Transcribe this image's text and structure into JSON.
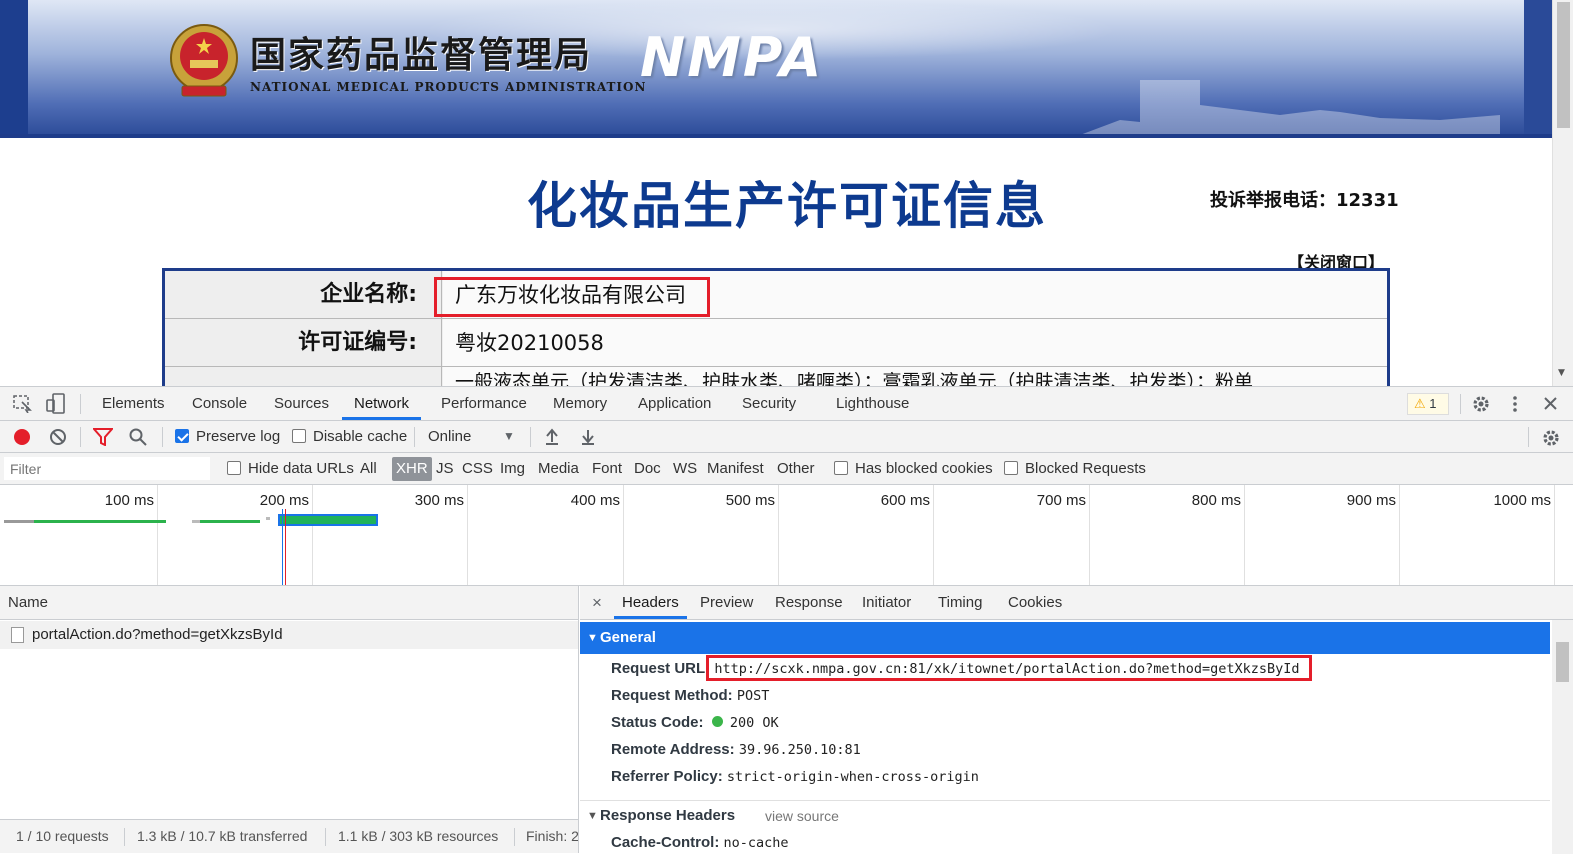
{
  "banner": {
    "org_name_cn": "国家药品监督管理局",
    "org_name_en": "NATIONAL MEDICAL PRODUCTS ADMINISTRATION",
    "org_abbr": "NMPA"
  },
  "page": {
    "title": "化妆品生产许可证信息",
    "hotline": "投诉举报电话：12331",
    "close_link": "【关闭窗口】",
    "rows": [
      {
        "label": "企业名称:",
        "value": "广东万妆化妆品有限公司"
      },
      {
        "label": "许可证编号:",
        "value": "粤妆20210058"
      },
      {
        "label": "",
        "value": "一般液态单元（护发清洁类、护肤水类、啫喱类）；膏霜乳液单元（护肤清洁类、护发类）；粉单"
      }
    ]
  },
  "devtools": {
    "tabs": [
      "Elements",
      "Console",
      "Sources",
      "Network",
      "Performance",
      "Memory",
      "Application",
      "Security",
      "Lighthouse"
    ],
    "active_tab": "Network",
    "warning_count": "1",
    "toolbar": {
      "preserve_log": "Preserve log",
      "disable_cache": "Disable cache",
      "throttling": "Online"
    },
    "filter": {
      "placeholder": "Filter",
      "hide_data_urls": "Hide data URLs",
      "types": [
        "All",
        "XHR",
        "JS",
        "CSS",
        "Img",
        "Media",
        "Font",
        "Doc",
        "WS",
        "Manifest",
        "Other"
      ],
      "active_type": "XHR",
      "has_blocked_cookies": "Has blocked cookies",
      "blocked_requests": "Blocked Requests"
    },
    "overview": {
      "ticks": [
        "100 ms",
        "200 ms",
        "300 ms",
        "400 ms",
        "500 ms",
        "600 ms",
        "700 ms",
        "800 ms",
        "900 ms",
        "1000 ms"
      ]
    },
    "requests": {
      "column_name": "Name",
      "rows": [
        "portalAction.do?method=getXkzsById"
      ]
    },
    "status": {
      "requests": "1 / 10 requests",
      "transferred": "1.3 kB / 10.7 kB transferred",
      "resources": "1.1 kB / 303 kB resources",
      "finish": "Finish: 2"
    },
    "detail": {
      "close": "×",
      "tabs": [
        "Headers",
        "Preview",
        "Response",
        "Initiator",
        "Timing",
        "Cookies"
      ],
      "active_tab": "Headers",
      "general_title": "General",
      "general": [
        {
          "key": "Request URL:",
          "value": "http://scxk.nmpa.gov.cn:81/xk/itownet/portalAction.do?method=getXkzsById"
        },
        {
          "key": "Request Method:",
          "value": "POST"
        },
        {
          "key": "Status Code:",
          "value": "200 OK"
        },
        {
          "key": "Remote Address:",
          "value": "39.96.250.10:81"
        },
        {
          "key": "Referrer Policy:",
          "value": "strict-origin-when-cross-origin"
        }
      ],
      "response_headers_title": "Response Headers",
      "view_source": "view source",
      "response_headers": [
        {
          "key": "Cache-Control:",
          "value": "no-cache"
        }
      ]
    }
  },
  "colors": {
    "accent": "#1a73e8",
    "highlight_box": "#e41e2a",
    "title_blue": "#0d3a8f",
    "status_ok": "#3bb54a"
  }
}
